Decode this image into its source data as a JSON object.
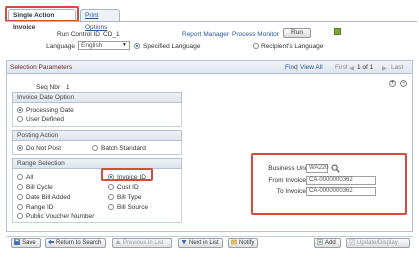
{
  "tabs": [
    {
      "label": "Single Action Invoice",
      "active": true
    },
    {
      "label": "Print Options",
      "active": false
    }
  ],
  "header": {
    "run_control_label": "Run Control ID",
    "run_control_value": "CD_1",
    "language_label": "Language",
    "language_value": "English",
    "language_opt_specified": "Specified Language",
    "language_opt_recipient": "Recipient's Language",
    "report_manager": "Report Manager",
    "process_monitor": "Process Monitor",
    "run_label": "Run"
  },
  "panel": {
    "title": "Selection Parameters",
    "find": "Find",
    "view_all": "View All",
    "first": "First",
    "count": "1 of 1",
    "last": "Last",
    "seq_label": "Seq Nbr",
    "seq_value": "1"
  },
  "invoice_date_option": {
    "title": "Invoice Date Option",
    "options": [
      "Processing Date",
      "User Defined"
    ],
    "selected": "Processing Date"
  },
  "posting_action": {
    "title": "Posting Action",
    "options": [
      "Do Not Post",
      "Batch Standard"
    ],
    "selected": "Do Not Post"
  },
  "range_selection": {
    "title": "Range Selection",
    "left_options": [
      "All",
      "Bill Cycle",
      "Date Bill Added",
      "Range ID",
      "Public Voucher Number"
    ],
    "right_options": [
      "Invoice ID",
      "Cust ID",
      "Bill Type",
      "Bill Source"
    ],
    "selected": "Invoice ID"
  },
  "criteria": {
    "business_unit_label": "Business Unit",
    "business_unit_value": "WA220",
    "from_invoice_label": "From Invoice",
    "from_invoice_value": "CA-0000000362",
    "to_invoice_label": "To Invoice",
    "to_invoice_value": "CA-0000000362"
  },
  "toolbar": {
    "save": "Save",
    "return_to_search": "Return to Search",
    "previous_in_list": "Previous in List",
    "next_in_list": "Next in List",
    "notify": "Notify",
    "add": "Add",
    "update_display": "Update/Display"
  },
  "colors": {
    "highlight": "#d44a3b",
    "link": "#2a5a9a",
    "panel_title": "#6a2a2a"
  }
}
